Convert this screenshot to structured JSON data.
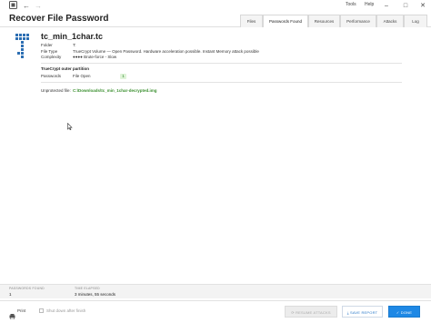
{
  "menu": {
    "tools": "Tools",
    "help": "Help"
  },
  "header": {
    "title": "Recover File Password"
  },
  "tabs": [
    "Files",
    "Passwords Found",
    "Resources",
    "Performance",
    "Attacks",
    "Log"
  ],
  "file": {
    "name": "tc_min_1char.tc",
    "rows": [
      {
        "label": "Folder",
        "value": "T:"
      },
      {
        "label": "File Type",
        "value": "TrueCrypt Volume — Open Password. Hardware acceleration possible. Instant Memory attack possible"
      },
      {
        "label": "Complexity",
        "value": "●●●●  Brute-force - Slow"
      }
    ]
  },
  "partition": {
    "title": "TrueCrypt outer partition",
    "password_label": "Passwords",
    "password_type": "File Open",
    "password_value": "1"
  },
  "unprotected": {
    "label": "Unprotected file:",
    "value": "C:\\Downloads\\tc_min_1char-decrypted.img"
  },
  "stats": {
    "passwords_found_label": "PASSWORDS FOUND",
    "passwords_found_value": "1",
    "time_elapsed_label": "TIME ELAPSED",
    "time_elapsed_value": "3 minutes, 55 seconds"
  },
  "footer": {
    "print_label": "Print",
    "shutdown_label": "Shut down after finish",
    "resume_label": "RESUME ATTACKS",
    "save_label": "SAVE REPORT",
    "done_label": "DONE"
  },
  "colors": {
    "accent": "#1e88e5",
    "success": "#3a8f2e"
  }
}
